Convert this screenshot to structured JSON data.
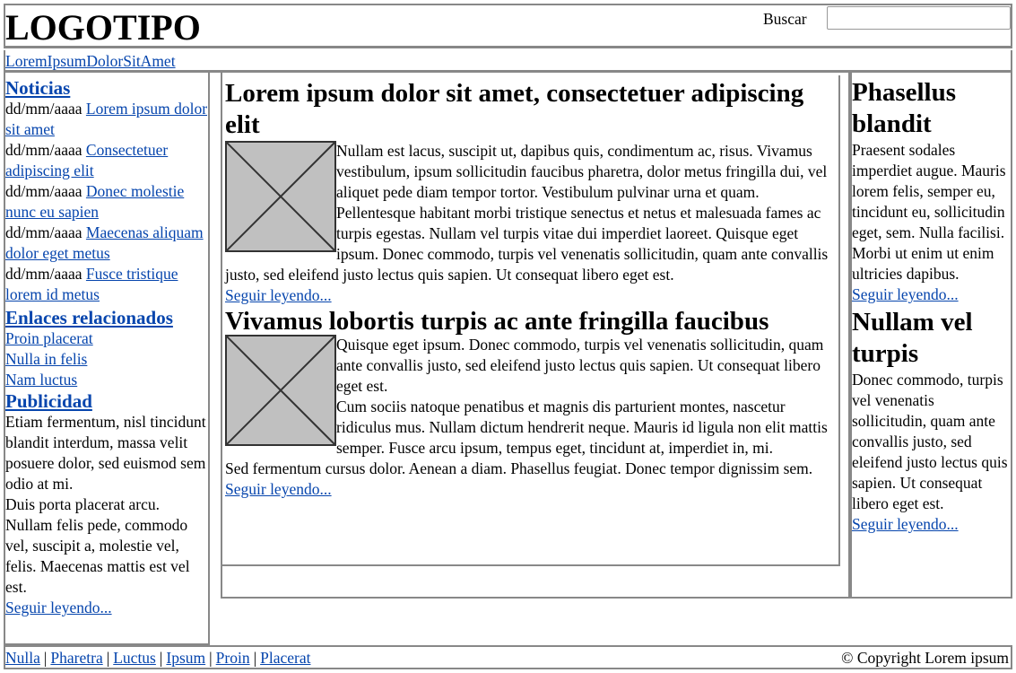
{
  "header": {
    "logo": "LOGOTIPO",
    "search_label": "Buscar",
    "search_value": ""
  },
  "nav": {
    "link": "LoremIpsumDolorSitAmet"
  },
  "left": {
    "news_title": "Noticias",
    "news": [
      {
        "date": "dd/mm/aaaa",
        "link": "Lorem ipsum dolor sit amet"
      },
      {
        "date": "dd/mm/aaaa",
        "link": "Consectetuer adipiscing elit"
      },
      {
        "date": "dd/mm/aaaa",
        "link": "Donec molestie nunc eu sapien"
      },
      {
        "date": "dd/mm/aaaa",
        "link": "Maecenas aliquam dolor eget metus"
      },
      {
        "date": "dd/mm/aaaa",
        "link": "Fusce tristique lorem id metus"
      }
    ],
    "related_title": "Enlaces relacionados",
    "related": [
      "Proin placerat",
      "Nulla in felis",
      "Nam luctus"
    ],
    "ads_title": "Publicidad",
    "ads_p1": "Etiam fermentum, nisl tincidunt blandit interdum, massa velit posuere dolor, sed euismod sem odio at mi.",
    "ads_p2": "Duis porta placerat arcu. Nullam felis pede, commodo vel, suscipit a, molestie vel, felis. Maecenas mattis est vel est.",
    "ads_more": "Seguir leyendo..."
  },
  "center": {
    "articles": [
      {
        "title": "Lorem ipsum dolor sit amet, consectetuer adipiscing elit",
        "p1": "Nullam est lacus, suscipit ut, dapibus quis, condimentum ac, risus. Vivamus vestibulum, ipsum sollicitudin faucibus pharetra, dolor metus fringilla dui, vel aliquet pede diam tempor tortor. Vestibulum pulvinar urna et quam. Pellentesque habitant morbi tristique senectus et netus et malesuada fames ac turpis egestas. Nullam vel turpis vitae dui imperdiet laoreet. Quisque eget ipsum. Donec commodo, turpis vel venenatis sollicitudin, quam ante convallis justo, sed eleifend justo lectus quis sapien. Ut consequat libero eget est.",
        "p2": "",
        "more": "Seguir leyendo..."
      },
      {
        "title": "Vivamus lobortis turpis ac ante fringilla faucibus",
        "p1": "Quisque eget ipsum. Donec commodo, turpis vel venenatis sollicitudin, quam ante convallis justo, sed eleifend justo lectus quis sapien. Ut consequat libero eget est.",
        "p2": "Cum sociis natoque penatibus et magnis dis parturient montes, nascetur ridiculus mus. Nullam dictum hendrerit neque. Mauris id ligula non elit mattis semper. Fusce arcu ipsum, tempus eget, tincidunt at, imperdiet in, mi.",
        "p3": "Sed fermentum cursus dolor. Aenean a diam. Phasellus feugiat. Donec tempor dignissim sem.",
        "more": "Seguir leyendo..."
      }
    ]
  },
  "right": {
    "blocks": [
      {
        "title": "Phasellus blandit",
        "text": "Praesent sodales imperdiet augue. Mauris lorem felis, semper eu, tincidunt eu, sollicitudin eget, sem. Nulla facilisi. Morbi ut enim ut enim ultricies dapibus.",
        "more": "Seguir leyendo..."
      },
      {
        "title": "Nullam vel turpis",
        "text": "Donec commodo, turpis vel venenatis sollicitudin, quam ante convallis justo, sed eleifend justo lectus quis sapien. Ut consequat libero eget est.",
        "more": "Seguir leyendo..."
      }
    ]
  },
  "footer": {
    "links": [
      "Nulla",
      "Pharetra",
      "Luctus",
      "Ipsum",
      "Proin",
      "Placerat"
    ],
    "separator": "|",
    "copyright": "© Copyright Lorem ipsum"
  },
  "colors": {
    "border": "#888888",
    "link": "#0645ad",
    "image_placeholder": "#c0c0c0"
  }
}
